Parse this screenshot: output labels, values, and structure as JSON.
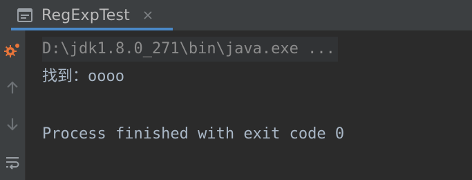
{
  "tab": {
    "title": "RegExpTest",
    "icon": "console-window-icon",
    "close_icon": "close-icon"
  },
  "gutter": {
    "buttons": [
      "run-debug-icon",
      "arrow-up-icon",
      "arrow-down-icon",
      "soft-wrap-icon"
    ]
  },
  "console": {
    "command_line": "D:\\jdk1.8.0_271\\bin\\java.exe ...",
    "output_line": "找到：oooo",
    "exit_line": "Process finished with exit code 0"
  },
  "colors": {
    "background": "#2b2b2b",
    "tabbar": "#3c3f41",
    "accent": "#4a88c7",
    "text": "#a9b7c6",
    "run_icon": "#e8753a"
  }
}
